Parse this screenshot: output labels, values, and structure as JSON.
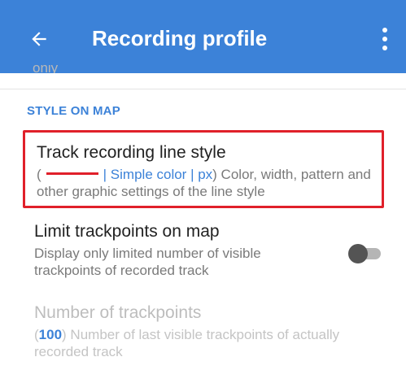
{
  "appbar": {
    "title": "Recording profile",
    "back_icon": "arrow-left-icon",
    "menu_icon": "more-vertical-icon",
    "color": "#3c82d8"
  },
  "cut_text": "only",
  "section": {
    "header": "STYLE ON MAP"
  },
  "line_style": {
    "title": "Track recording line style",
    "open_paren": "(",
    "line_color": "#e0202a",
    "style_info": "| Simple color | px",
    "summary_rest": ") Color, width, pattern and other graphic settings of the line style",
    "highlight_color": "#e0202a"
  },
  "limit_trackpoints": {
    "title": "Limit trackpoints on map",
    "summary": "Display only limited number of visible trackpoints of recorded track",
    "enabled": false
  },
  "number_of_trackpoints": {
    "title": "Number of trackpoints",
    "open_paren": "(",
    "value": "100",
    "summary_rest": ") Number of last visible trackpoints of actually recorded track",
    "disabled": true
  }
}
